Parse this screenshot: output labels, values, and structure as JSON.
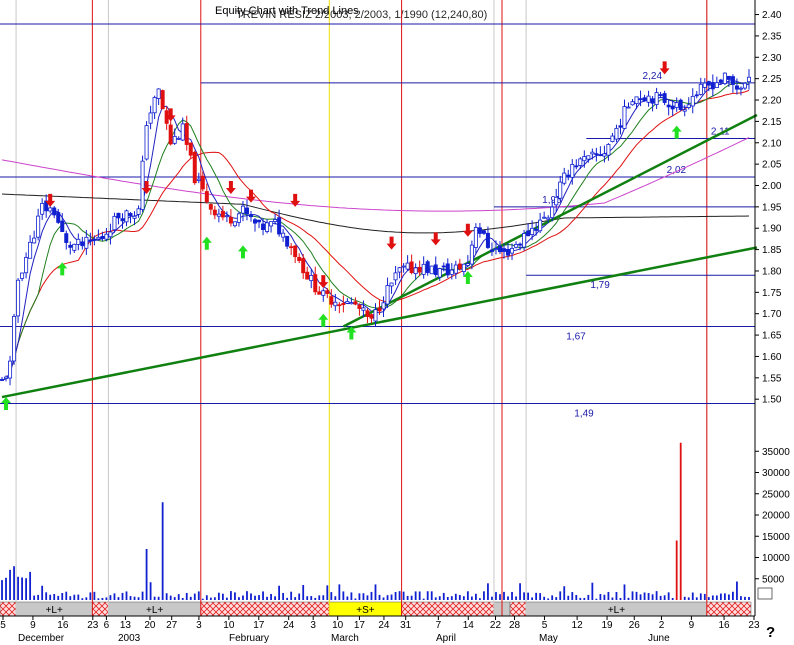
{
  "chart_data": {
    "type": "candlestick",
    "title": "Equity Chart with Trend Lines",
    "title_overlap": "TREVIN RESIZ 2/2003, 2/2003, 1/1990 (12,240,80)",
    "help_glyph": "?",
    "price_axis": {
      "min": 1.47,
      "max": 2.42,
      "ticks": [
        "1.50",
        "1.55",
        "1.60",
        "1.65",
        "1.70",
        "1.75",
        "1.80",
        "1.85",
        "1.90",
        "1.95",
        "2.00",
        "2.05",
        "2.10",
        "2.15",
        "2.20",
        "2.25",
        "2.30",
        "2.35",
        "2.40"
      ]
    },
    "volume_axis": {
      "min": 0,
      "max": 40000,
      "ticks": [
        "5000",
        "10000",
        "15000",
        "20000",
        "25000",
        "30000",
        "35000"
      ]
    },
    "x_tick_labels": [
      "5",
      "9",
      "16",
      "23",
      "6",
      "13",
      "20",
      "27",
      "3",
      "10",
      "17",
      "24",
      "3",
      "10",
      "17",
      "24",
      "31",
      "7",
      "14",
      "22",
      "28",
      "5",
      "12",
      "19",
      "26",
      "2",
      "9",
      "16",
      "23"
    ],
    "month_labels": [
      "December",
      "2003",
      "February",
      "March",
      "April",
      "May",
      "June"
    ],
    "horizontal_levels": [
      {
        "value": 2.24,
        "label": "2,24"
      },
      {
        "value": 2.11,
        "label": "2,11"
      },
      {
        "value": 2.02,
        "label": "2,02"
      },
      {
        "value": 1.95,
        "label": "1,95"
      },
      {
        "value": 1.79,
        "label": "1,79"
      },
      {
        "value": 1.67,
        "label": "1,67"
      },
      {
        "value": 1.49,
        "label": "1,49"
      }
    ],
    "trendlines": [
      {
        "name": "lower",
        "from": [
          0,
          1.505
        ],
        "to": [
          185,
          1.855
        ]
      },
      {
        "name": "upper",
        "from": [
          85,
          1.67
        ],
        "to": [
          185,
          2.165
        ]
      }
    ],
    "signal_strip": [
      {
        "from": 0,
        "to": 4,
        "label": "",
        "kind": "hatch"
      },
      {
        "from": 4,
        "to": 23,
        "label": "+L+",
        "kind": "gray"
      },
      {
        "from": 23,
        "to": 27,
        "label": "",
        "kind": "hatch"
      },
      {
        "from": 27,
        "to": 50,
        "label": "+L+",
        "kind": "gray"
      },
      {
        "from": 50,
        "to": 82,
        "label": "",
        "kind": "hatch"
      },
      {
        "from": 82,
        "to": 100,
        "label": "+S+",
        "kind": "yellow"
      },
      {
        "from": 100,
        "to": 123,
        "label": "",
        "kind": "hatch"
      },
      {
        "from": 123,
        "to": 127,
        "label": "",
        "kind": "gray"
      },
      {
        "from": 127,
        "to": 131,
        "label": "",
        "kind": "hatch"
      },
      {
        "from": 131,
        "to": 176,
        "label": "+L+",
        "kind": "gray"
      },
      {
        "from": 176,
        "to": 187,
        "label": "",
        "kind": "hatch"
      }
    ],
    "grid": false,
    "legend": "none"
  }
}
